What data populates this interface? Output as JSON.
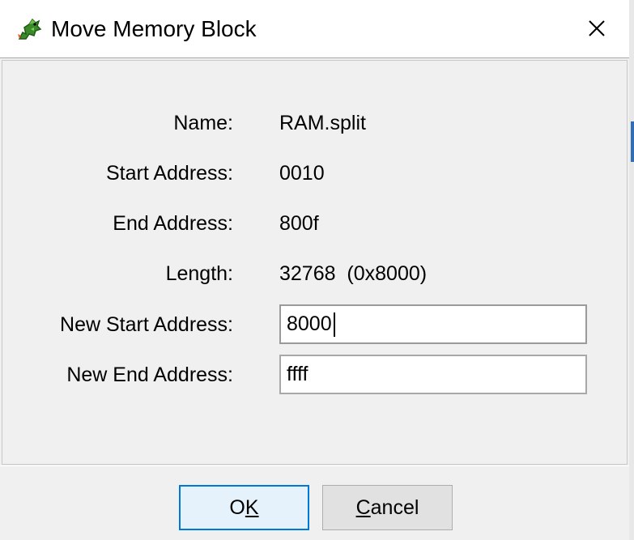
{
  "window": {
    "title": "Move Memory Block",
    "app_icon": "dragon-icon",
    "close_icon": "close-icon"
  },
  "form": {
    "name_label": "Name:",
    "name_value": "RAM.split",
    "start_label": "Start Address:",
    "start_value": "0010",
    "end_label": "End Address:",
    "end_value": "800f",
    "length_label": "Length:",
    "length_value": "32768  (0x8000)",
    "new_start_label": "New Start Address:",
    "new_start_value": "8000",
    "new_end_label": "New End Address:",
    "new_end_value": "ffff"
  },
  "buttons": {
    "ok_pre": "O",
    "ok_mnemonic": "K",
    "ok_post": "",
    "cancel_pre": "",
    "cancel_mnemonic": "C",
    "cancel_post": "ancel"
  },
  "colors": {
    "accent": "#0078d7",
    "dialog_bg": "#f0f0f0"
  }
}
